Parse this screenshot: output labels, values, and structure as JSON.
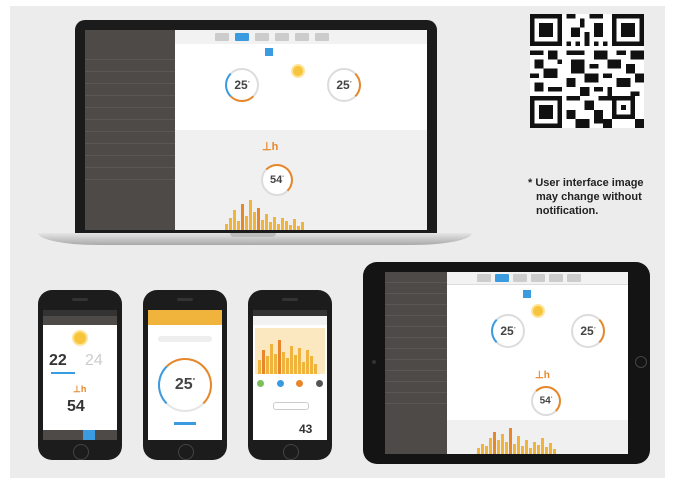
{
  "note": {
    "line1": "* User interface image",
    "line2": "may change without",
    "line3": "notification."
  },
  "laptop": {
    "temp_left": "25",
    "temp_right": "25",
    "water_temp": "54"
  },
  "phones": [
    {
      "temp_main": "22",
      "temp_secondary": "24",
      "water_temp": "54"
    },
    {
      "temp_main": "25"
    },
    {
      "energy_value": "43"
    }
  ],
  "tablet": {
    "temp_left": "25",
    "temp_right": "25",
    "water_temp": "54"
  },
  "colors": {
    "accent": "#3a9be0",
    "heating": "#e7872a",
    "bars": "#f0b43c",
    "sidebar": "#4d4a47",
    "background": "#ececec"
  },
  "icons": [
    "qr-code-icon",
    "sun-icon",
    "water-tap-icon"
  ]
}
